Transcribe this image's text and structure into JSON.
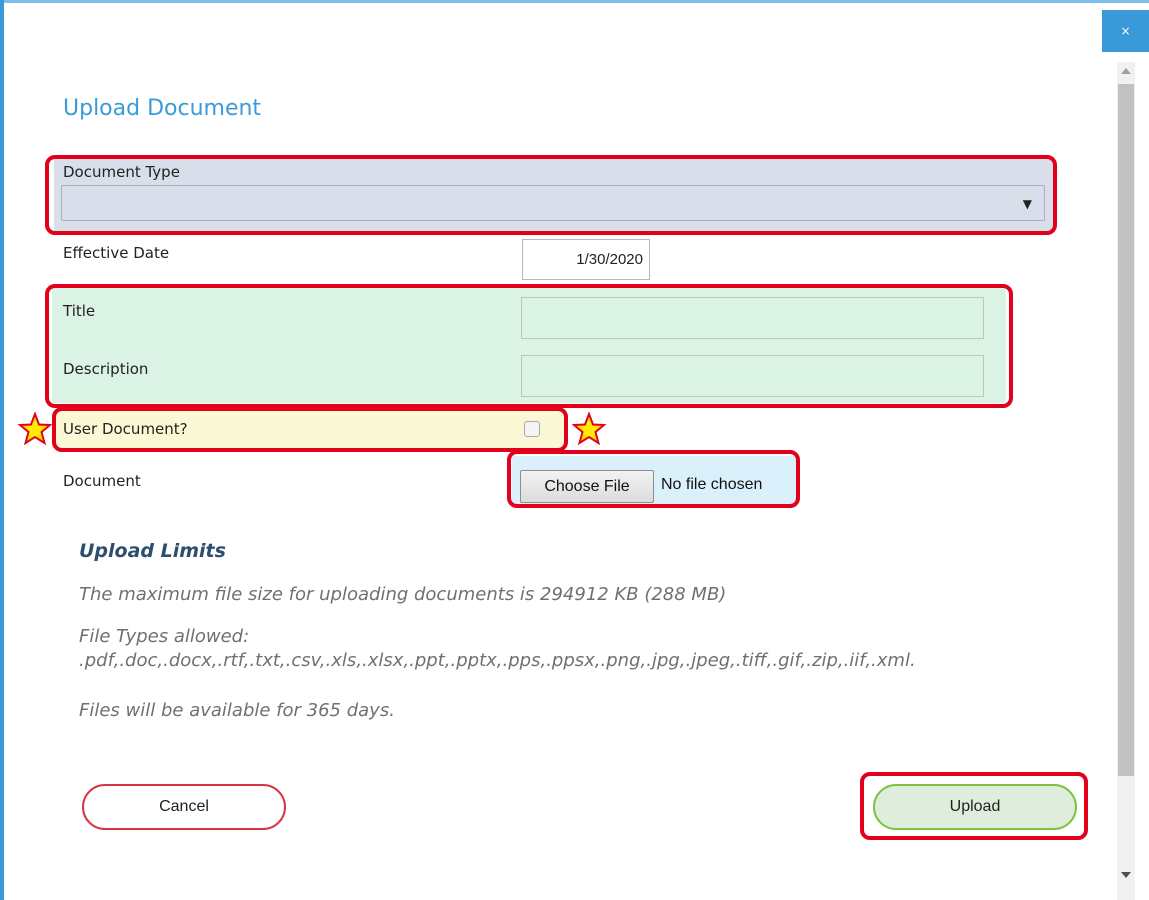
{
  "dialog": {
    "title": "Upload Document",
    "close_label": "×"
  },
  "form": {
    "document_type_label": "Document Type",
    "document_type_value": "",
    "effective_date_label": "Effective Date",
    "effective_date_value": "1/30/2020",
    "title_label": "Title",
    "title_value": "",
    "description_label": "Description",
    "description_value": "",
    "user_document_label": "User Document?",
    "user_document_checked": false,
    "document_label": "Document",
    "choose_file_label": "Choose File",
    "file_status": "No file chosen"
  },
  "limits": {
    "heading": "Upload Limits",
    "max_size_text": "The maximum file size for uploading documents is 294912 KB (288 MB)",
    "file_types_label": "File Types allowed:",
    "file_types_list": ".pdf,.doc,.docx,.rtf,.txt,.csv,.xls,.xlsx,.ppt,.pptx,.pps,.ppsx,.png,.jpg,.jpeg,.tiff,.gif,.zip,.iif,.xml.",
    "availability_text": "Files will be available for 365 days."
  },
  "actions": {
    "cancel_label": "Cancel",
    "upload_label": "Upload"
  },
  "colors": {
    "accent": "#3b9bd8",
    "highlight": "#e3001b",
    "cancel_border": "#d9343f",
    "upload_border": "#7dc241"
  },
  "icons": {
    "close": "close-icon",
    "dropdown": "chevron-down-icon",
    "star": "star-icon"
  }
}
